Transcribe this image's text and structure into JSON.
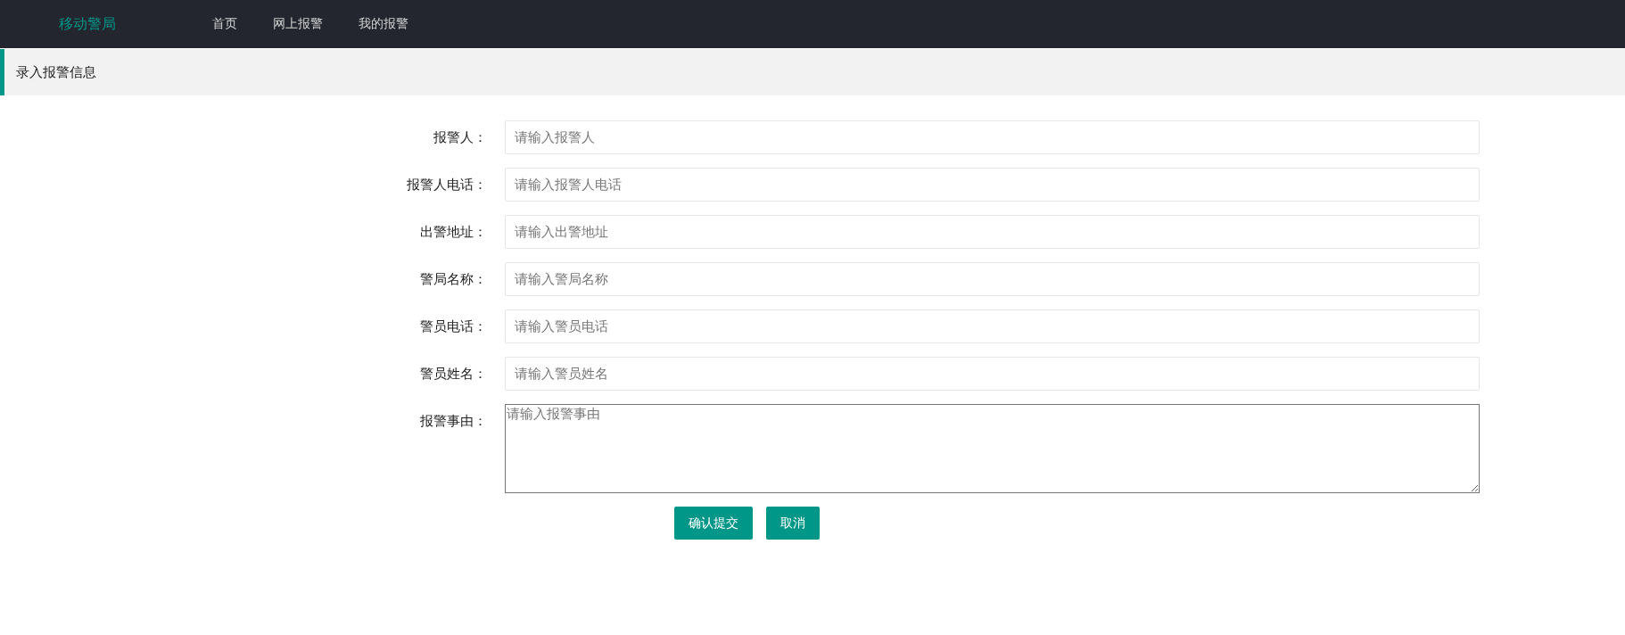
{
  "navbar": {
    "logo": "移动警局",
    "items": [
      {
        "label": "首页"
      },
      {
        "label": "网上报警"
      },
      {
        "label": "我的报警"
      }
    ]
  },
  "section_title": "录入报警信息",
  "form": {
    "fields": [
      {
        "kind": "input",
        "label": "报警人：",
        "placeholder": "请输入报警人"
      },
      {
        "kind": "input",
        "label": "报警人电话：",
        "placeholder": "请输入报警人电话"
      },
      {
        "kind": "input",
        "label": "出警地址：",
        "placeholder": "请输入出警地址"
      },
      {
        "kind": "input",
        "label": "警局名称：",
        "placeholder": "请输入警局名称"
      },
      {
        "kind": "input",
        "label": "警员电话：",
        "placeholder": "请输入警员电话"
      },
      {
        "kind": "input",
        "label": "警员姓名：",
        "placeholder": "请输入警员姓名"
      },
      {
        "kind": "textarea",
        "label": "报警事由：",
        "placeholder": "请输入报警事由"
      }
    ],
    "buttons": [
      "确认提交",
      "取消"
    ]
  }
}
